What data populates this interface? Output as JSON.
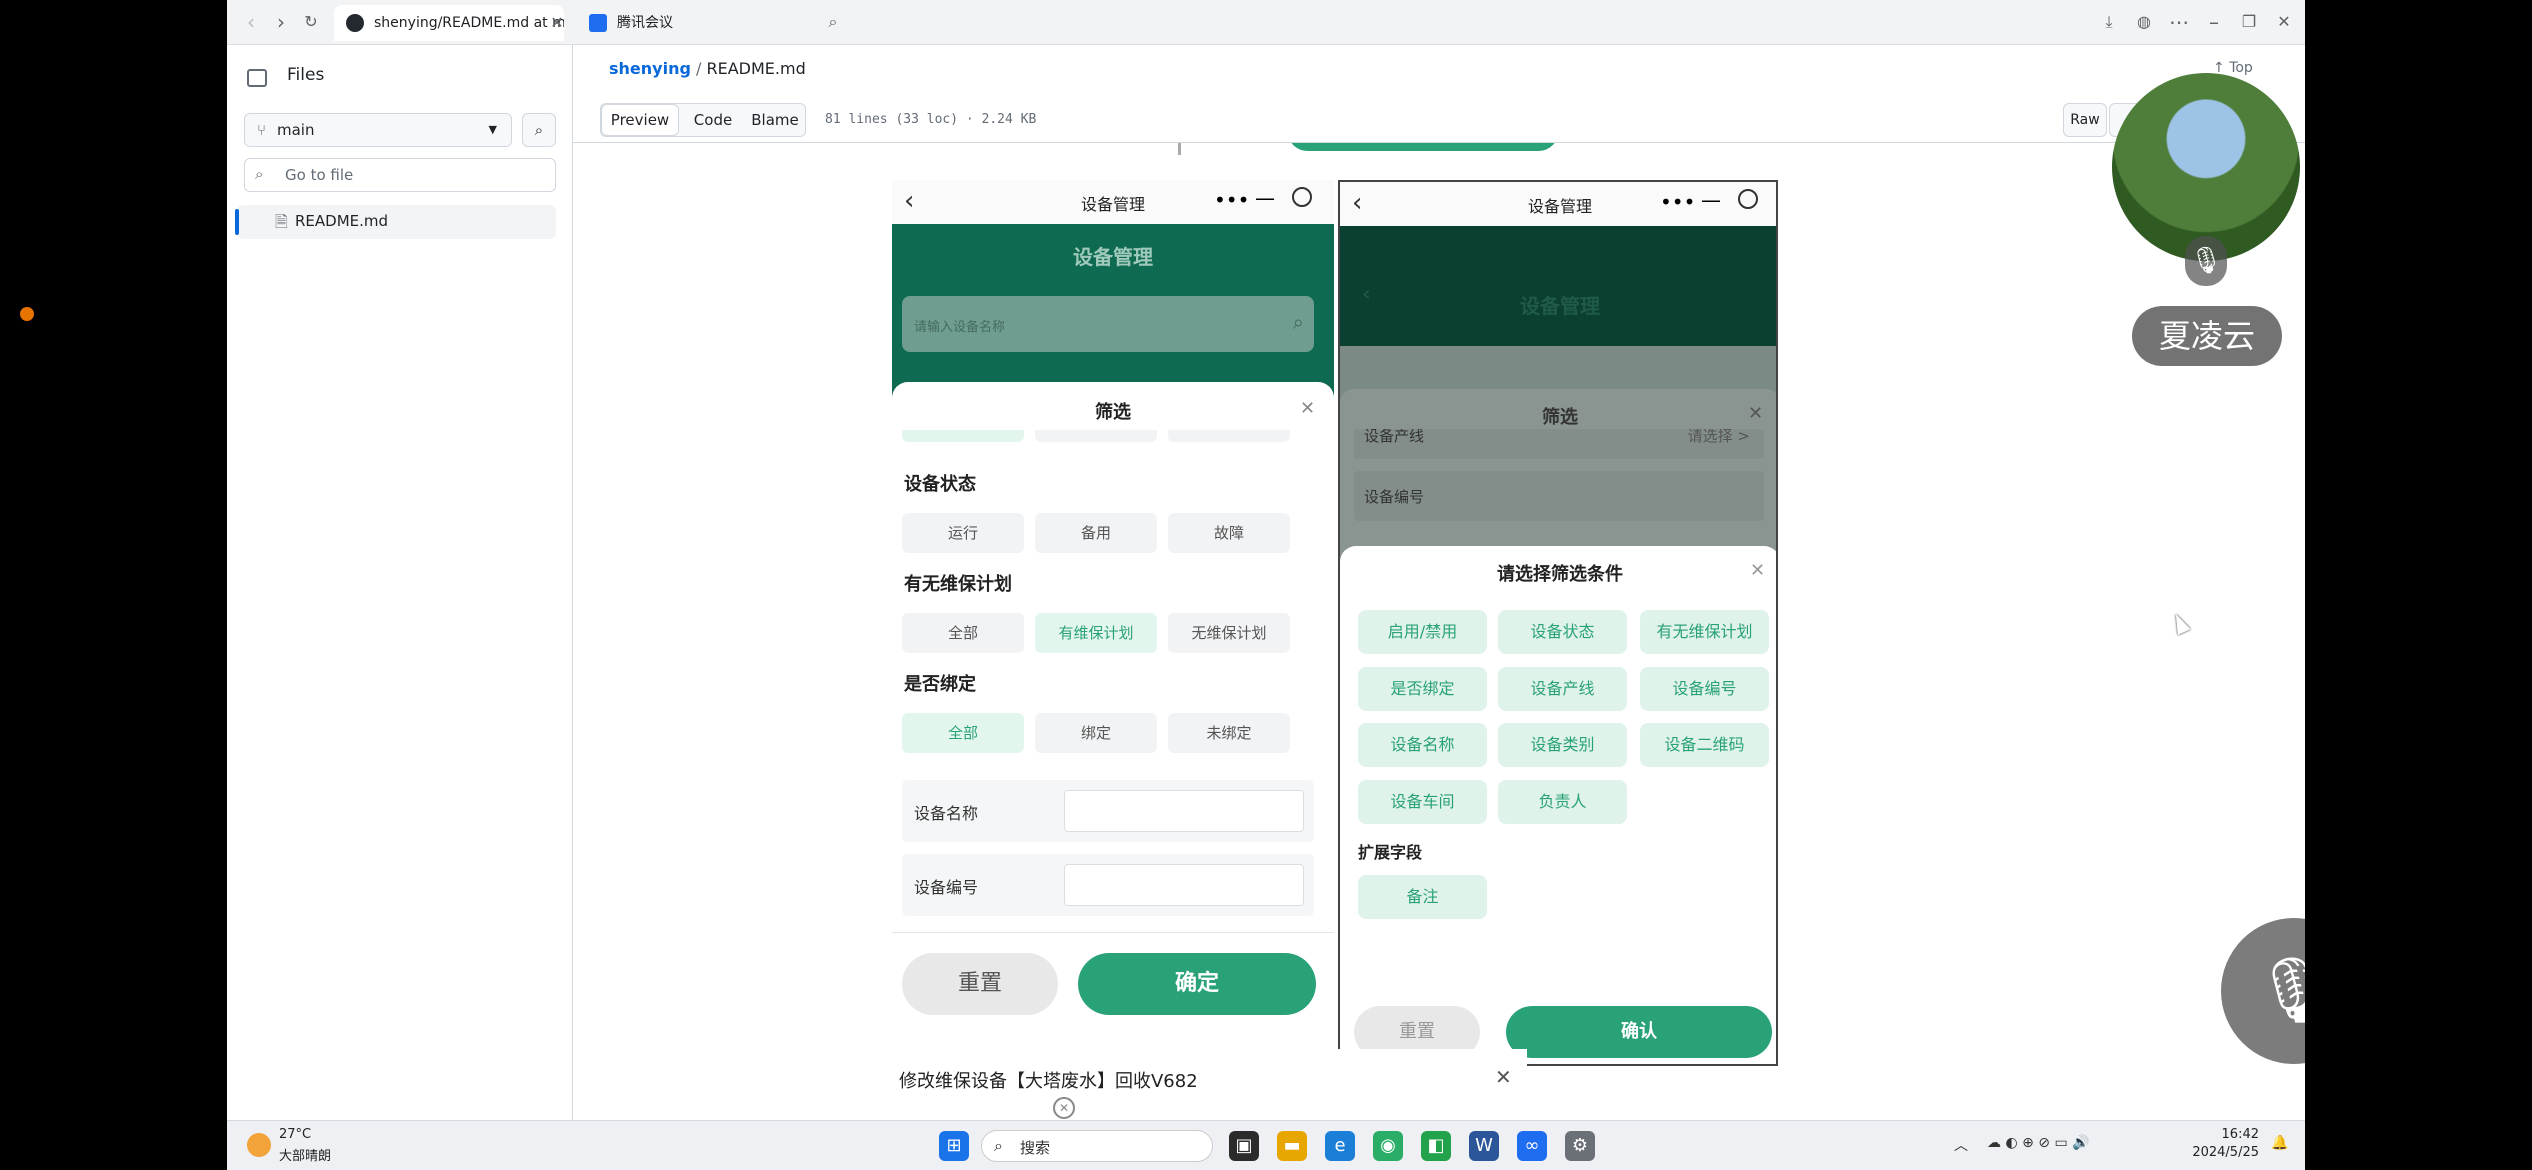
{
  "browser": {
    "tabs": [
      {
        "title": "shenying/README.md at m"
      },
      {
        "title": "腾讯会议"
      }
    ]
  },
  "sidebar": {
    "title": "Files",
    "branch": "main",
    "goto_placeholder": "Go to file",
    "files": [
      "README.md"
    ]
  },
  "header": {
    "repo": "shenying",
    "sep": "/",
    "file": "README.md",
    "top": "Top"
  },
  "toolbar": {
    "preview": "Preview",
    "code": "Code",
    "blame": "Blame",
    "meta": "81 lines (33 loc) · 2.24 KB",
    "raw": "Raw"
  },
  "left_phone": {
    "nav_title": "设备管理",
    "header_title": "设备管理",
    "search_placeholder": "请输入设备名称",
    "sheet_title": "筛选",
    "status_label": "设备状态",
    "status_options": [
      "运行",
      "备用",
      "故障"
    ],
    "plan_label": "有无维保计划",
    "plan_options": [
      "全部",
      "有维保计划",
      "无维保计划"
    ],
    "bind_label": "是否绑定",
    "bind_options": [
      "全部",
      "绑定",
      "未绑定"
    ],
    "name_label": "设备名称",
    "code_label": "设备编号",
    "reset": "重置",
    "confirm": "确定"
  },
  "right_phone": {
    "nav_title": "设备管理",
    "bg_title": "设备管理",
    "filter_title": "筛选",
    "row1_label": "设备产线",
    "row1_value": "请选择 >",
    "row2_label": "设备编号",
    "sheet_title": "请选择筛选条件",
    "options": [
      "启用/禁用",
      "设备状态",
      "有无维保计划",
      "是否绑定",
      "设备产线",
      "设备编号",
      "设备名称",
      "设备类别",
      "设备二维码",
      "设备车间",
      "负责人"
    ],
    "ext_label": "扩展字段",
    "ext_options": [
      "备注"
    ],
    "reset": "重置",
    "confirm": "确认"
  },
  "below": {
    "title": "修改维保设备【大塔废水】回收V682"
  },
  "meeting": {
    "user": "夏凌云"
  },
  "taskbar": {
    "weather_temp": "27°C",
    "weather_desc": "大部晴朗",
    "search": "搜索",
    "time": "16:42",
    "date": "2024/5/25"
  }
}
